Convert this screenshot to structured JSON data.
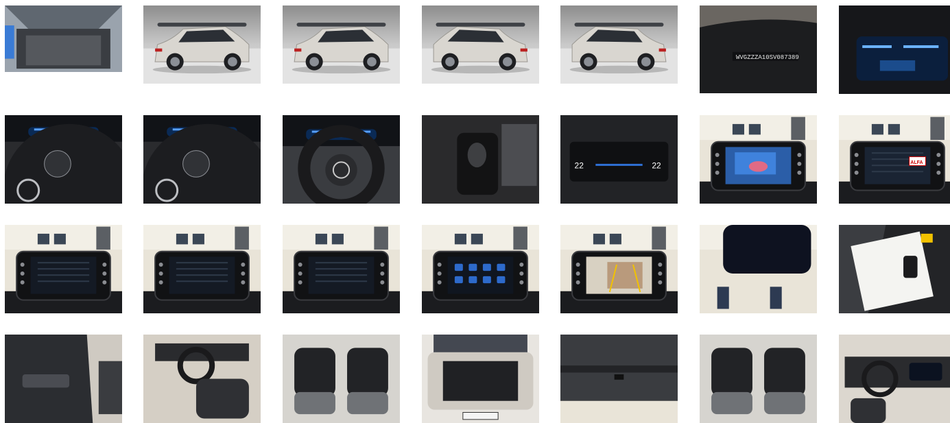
{
  "gallery": {
    "items": [
      {
        "subject": "car-boot-open-hatch"
      },
      {
        "subject": "car-exterior-front-left"
      },
      {
        "subject": "car-exterior-front-side"
      },
      {
        "subject": "car-exterior-rear-left"
      },
      {
        "subject": "car-exterior-rear-side"
      },
      {
        "subject": "windshield-vin-plate",
        "vin": "WVGZZZA10SV087389"
      },
      {
        "subject": "digital-cockpit-display"
      },
      {
        "subject": "steering-wheel-controls-left"
      },
      {
        "subject": "steering-wheel-logo-closeup"
      },
      {
        "subject": "steering-wheel-dashboard"
      },
      {
        "subject": "gear-shifter-console"
      },
      {
        "subject": "climate-control-panel",
        "left_temp": "22",
        "right_temp": "22"
      },
      {
        "subject": "infotainment-navigation"
      },
      {
        "subject": "infotainment-radio",
        "badge": "ALFA"
      },
      {
        "subject": "infotainment-phone-setup"
      },
      {
        "subject": "infotainment-bluetooth"
      },
      {
        "subject": "infotainment-connect-menu"
      },
      {
        "subject": "infotainment-home-apps"
      },
      {
        "subject": "infotainment-rear-camera"
      },
      {
        "subject": "rear-view-mirror"
      },
      {
        "subject": "keys-and-documents"
      },
      {
        "subject": "driver-door-panel"
      },
      {
        "subject": "front-interior-seats"
      },
      {
        "subject": "rear-seats-left"
      },
      {
        "subject": "car-rear-boot-view"
      },
      {
        "subject": "tailgate-interior"
      },
      {
        "subject": "rear-seats-right"
      },
      {
        "subject": "dashboard-passenger-side"
      }
    ]
  }
}
